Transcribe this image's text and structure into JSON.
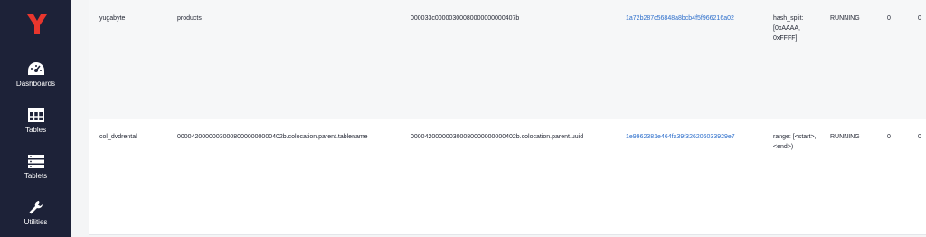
{
  "sidebar": {
    "items": [
      {
        "label": "Dashboards",
        "icon": "dashboard-gauge-icon"
      },
      {
        "label": "Tables",
        "icon": "table-grid-icon"
      },
      {
        "label": "Tablets",
        "icon": "server-stack-icon"
      },
      {
        "label": "Utilities",
        "icon": "wrench-icon"
      }
    ],
    "brand_color": "#e8362d",
    "background": "#1d2238"
  },
  "rows": [
    {
      "keyspace": "yugabyte",
      "table_name": "products",
      "table_id": "000033c00000300080000000000407b",
      "tablet_uuid": "1a72b287c56848a8bcb4f5f966216a02",
      "partition": "hash_split: [0xAAAA, 0xFFFF]",
      "state": "RUNNING",
      "col_a": "0",
      "col_b": "0"
    },
    {
      "keyspace": "col_dvdrental",
      "table_name": "000042000000300080000000000402b.colocation.parent.tablename",
      "table_id": "000042000000300080000000000402b.colocation.parent.uuid",
      "tablet_uuid": "1e9962381e464fa39f326206033929e7",
      "partition": "range: [<start>, <end>)",
      "state": "RUNNING",
      "col_a": "0",
      "col_b": "0"
    }
  ],
  "colors": {
    "link": "#2c6ecb",
    "text": "#1f2330"
  }
}
